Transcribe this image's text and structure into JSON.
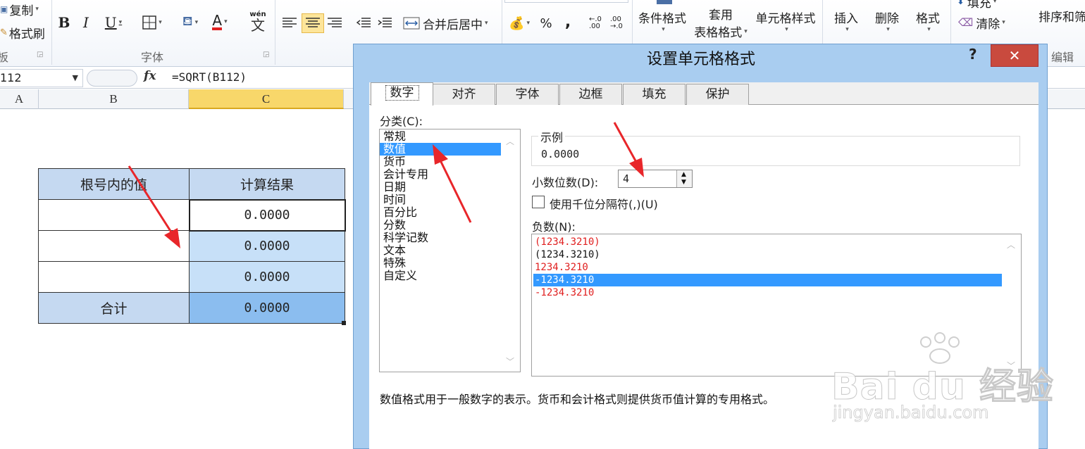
{
  "ribbon": {
    "clipboard": {
      "copy": "复制",
      "format_painter": "格式刷",
      "group_label_fragment": "板"
    },
    "font": {
      "group_label": "字体",
      "bold": "B",
      "italic": "I",
      "underline": "U",
      "font_color_letter": "A",
      "phonetic_top": "wén",
      "phonetic_glyph": "文"
    },
    "alignment": {
      "merge_center": "合并后居中"
    },
    "number": {
      "percent": "%",
      "comma": ",",
      "inc_decimal": "←.0 .00",
      "dec_decimal": ".00 →.0"
    },
    "styles": {
      "conditional": "条件格式",
      "table_format_1": "套用",
      "table_format_2": "表格格式",
      "cell_styles": "单元格样式"
    },
    "cells": {
      "insert": "插入",
      "delete": "删除",
      "format": "格式"
    },
    "editing": {
      "fill": "填充",
      "clear": "清除",
      "sort": "排序和筛",
      "group_label": "编辑"
    }
  },
  "formula_bar": {
    "name_box": "112",
    "fx": "fx",
    "formula": "=SQRT(B112)"
  },
  "columns": [
    "A",
    "B",
    "C"
  ],
  "sheet": {
    "header": [
      "根号内的值",
      "计算结果"
    ],
    "rows": [
      {
        "value": "",
        "result": "0.0000"
      },
      {
        "value": "",
        "result": "0.0000"
      },
      {
        "value": "",
        "result": "0.0000"
      }
    ],
    "total_label": "合计",
    "total_value": "0.0000"
  },
  "dialog": {
    "title": "设置单元格格式",
    "help": "?",
    "close": "✕",
    "tabs": [
      "数字",
      "对齐",
      "字体",
      "边框",
      "填充",
      "保护"
    ],
    "active_tab": "数字",
    "category_label": "分类(C):",
    "categories": [
      "常规",
      "数值",
      "货币",
      "会计专用",
      "日期",
      "时间",
      "百分比",
      "分数",
      "科学记数",
      "文本",
      "特殊",
      "自定义"
    ],
    "selected_category": "数值",
    "sample_label": "示例",
    "sample_value": "0.0000",
    "decimals_label": "小数位数(D):",
    "decimals_value": "4",
    "thousands_label": "使用千位分隔符(,)(U)",
    "thousands_checked": false,
    "negative_label": "负数(N):",
    "negatives": [
      {
        "text": "(1234.3210)",
        "color": "red"
      },
      {
        "text": "(1234.3210)",
        "color": "black"
      },
      {
        "text": "1234.3210",
        "color": "red"
      },
      {
        "text": "-1234.3210",
        "color": "black",
        "selected": true
      },
      {
        "text": "-1234.3210",
        "color": "red"
      }
    ],
    "description": "数值格式用于一般数字的表示。货币和会计格式则提供货币值计算的专用格式。"
  },
  "watermark": {
    "brand": "Bai du 经验",
    "url": "jingyan.baidu.com"
  },
  "colors": {
    "accent_selection": "#3399ff",
    "annotation_arrow": "#e8262a",
    "dialog_frame": "#a9cdf0",
    "close_button": "#c94a3e"
  }
}
